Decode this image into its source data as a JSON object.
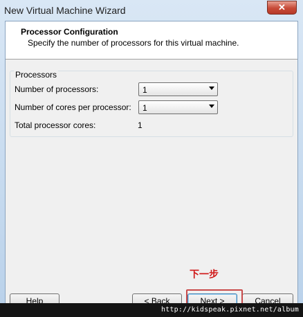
{
  "window": {
    "title": "New Virtual Machine Wizard",
    "close_glyph": "✕"
  },
  "header": {
    "title": "Processor Configuration",
    "subtitle": "Specify the number of processors for this virtual machine."
  },
  "processors": {
    "group_label": "Processors",
    "num_processors_label": "Number of processors:",
    "num_processors_value": "1",
    "cores_label": "Number of cores per processor:",
    "cores_value": "1",
    "total_label": "Total processor cores:",
    "total_value": "1"
  },
  "buttons": {
    "help": "Help",
    "back": "< Back",
    "next": "Next >",
    "cancel": "Cancel"
  },
  "annotation": {
    "text": "下一步",
    "color": "#d01818"
  },
  "watermark": {
    "text": "http://kidspeak.pixnet.net/album"
  }
}
